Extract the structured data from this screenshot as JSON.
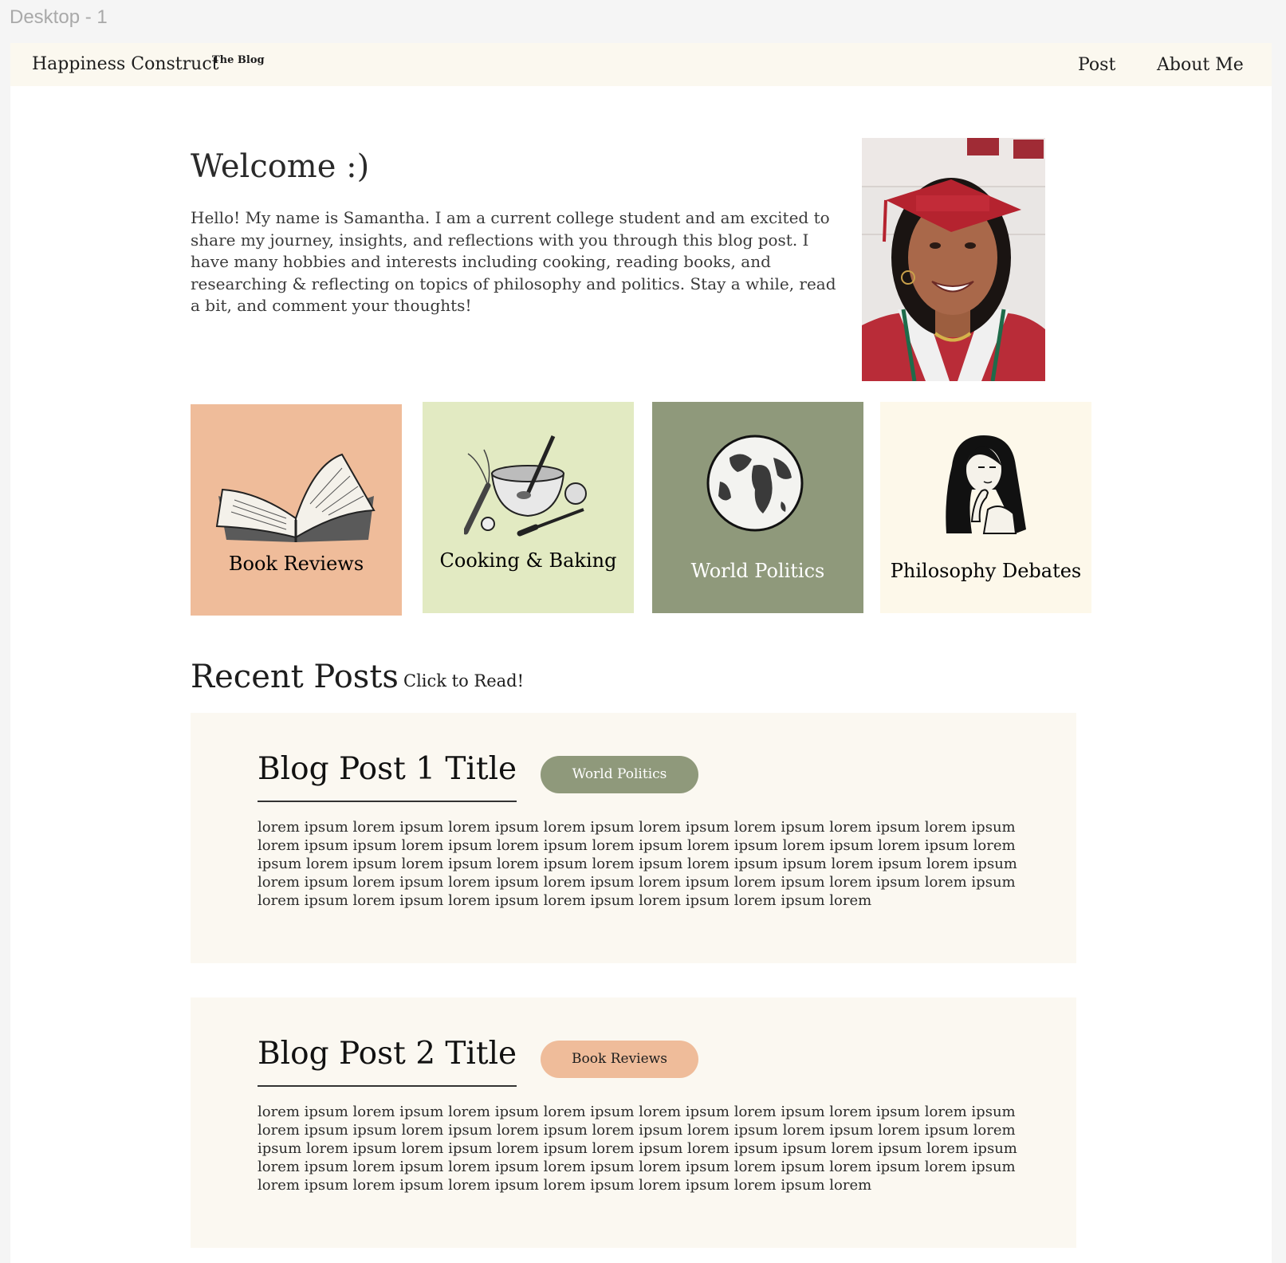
{
  "canvas": {
    "frame_label": "Desktop - 1"
  },
  "navbar": {
    "brand": "Happiness Construct",
    "brand_sup": "The Blog",
    "links": [
      "Post",
      "About Me"
    ]
  },
  "welcome": {
    "title": "Welcome :)",
    "text": "Hello! My name is Samantha. I am a current college student and am excited to share my journey, insights, and reflections with you through this blog post. I have many hobbies and interests including cooking, reading books, and  researching & reflecting on topics of philosophy and politics. Stay a while, read a bit, and comment your thoughts!"
  },
  "categories": [
    {
      "label": "Book Reviews",
      "icon": "open-book-icon",
      "bg": "#efbc9a",
      "text_color": "#1d1d1d"
    },
    {
      "label": "Cooking & Baking",
      "icon": "cooking-bowl-icon",
      "bg": "#e2eac2",
      "text_color": "#1d1d1d"
    },
    {
      "label": "World Politics",
      "icon": "globe-icon",
      "bg": "#8f997b",
      "text_color": "#ffffff"
    },
    {
      "label": "Philosophy Debates",
      "icon": "thinking-woman-icon",
      "bg": "#fdf8ea",
      "text_color": "#1d1d1d"
    }
  ],
  "recent": {
    "title": "Recent Posts",
    "subtitle": "Click to Read!"
  },
  "posts": [
    {
      "title": "Blog Post 1 Title",
      "tag": "World Politics",
      "tag_bg": "#8f997b",
      "tag_color": "#ffffff",
      "body": "lorem ipsum lorem ipsum lorem ipsum lorem ipsum lorem ipsum lorem ipsum lorem ipsum lorem ipsum lorem ipsum ipsum lorem ipsum lorem ipsum lorem ipsum lorem ipsum lorem ipsum lorem ipsum lorem ipsum lorem ipsum lorem ipsum lorem ipsum lorem ipsum lorem ipsum ipsum lorem ipsum lorem ipsum lorem ipsum lorem ipsum lorem ipsum lorem ipsum lorem ipsum lorem ipsum lorem ipsum lorem ipsum lorem ipsum lorem ipsum lorem ipsum lorem ipsum lorem ipsum lorem ipsum lorem"
    },
    {
      "title": "Blog Post 2 Title",
      "tag": "Book Reviews",
      "tag_bg": "#efbc9a",
      "tag_color": "#1d1d1d",
      "body": "lorem ipsum lorem ipsum lorem ipsum lorem ipsum lorem ipsum lorem ipsum lorem ipsum lorem ipsum lorem ipsum ipsum lorem ipsum lorem ipsum lorem ipsum lorem ipsum lorem ipsum lorem ipsum lorem ipsum lorem ipsum lorem ipsum lorem ipsum lorem ipsum lorem ipsum ipsum lorem ipsum lorem ipsum lorem ipsum lorem ipsum lorem ipsum lorem ipsum lorem ipsum lorem ipsum lorem ipsum lorem ipsum lorem ipsum lorem ipsum lorem ipsum lorem ipsum lorem ipsum lorem ipsum lorem"
    }
  ]
}
